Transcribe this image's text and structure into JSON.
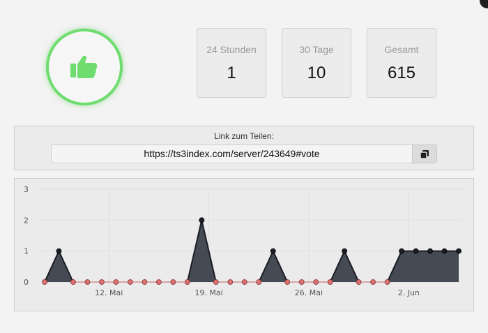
{
  "window": {
    "close_icon": "close-icon"
  },
  "badge": {
    "icon": "thumbs-up-icon",
    "color": "#6fdc6f"
  },
  "stats": [
    {
      "label": "24 Stunden",
      "value": "1"
    },
    {
      "label": "30 Tage",
      "value": "10"
    },
    {
      "label": "Gesamt",
      "value": "615"
    }
  ],
  "share": {
    "title": "Link zum Teilen:",
    "url": "https://ts3index.com/server/243649#vote",
    "copy_icon": "copy-icon"
  },
  "chart_data": {
    "type": "area",
    "title": "",
    "xlabel": "",
    "ylabel": "",
    "x_tick_labels": [
      "12. Mai",
      "19. Mai",
      "26. Mai",
      "2. Jun"
    ],
    "y_tick_labels": [
      "0",
      "1",
      "2",
      "3"
    ],
    "ylim": [
      0,
      3
    ],
    "grid": true,
    "fill_color": "#454a54",
    "zero_point_color": "#e07070",
    "nonzero_point_color": "#1a1d24",
    "x": [
      "7.5.",
      "8.5.",
      "9.5.",
      "10.5.",
      "11.5.",
      "12.5.",
      "13.5.",
      "14.5.",
      "15.5.",
      "16.5.",
      "17.5.",
      "18.5.",
      "19.5.",
      "20.5.",
      "21.5.",
      "22.5.",
      "23.5.",
      "24.5.",
      "25.5.",
      "26.5.",
      "27.5.",
      "28.5.",
      "29.5.",
      "30.5.",
      "31.5.",
      "1.6.",
      "2.6.",
      "3.6.",
      "4.6.",
      "5.6."
    ],
    "values": [
      0,
      1,
      0,
      0,
      0,
      0,
      0,
      0,
      0,
      0,
      0,
      2,
      0,
      0,
      0,
      0,
      1,
      0,
      0,
      0,
      0,
      1,
      0,
      0,
      0,
      1,
      1,
      1,
      1,
      1
    ]
  }
}
